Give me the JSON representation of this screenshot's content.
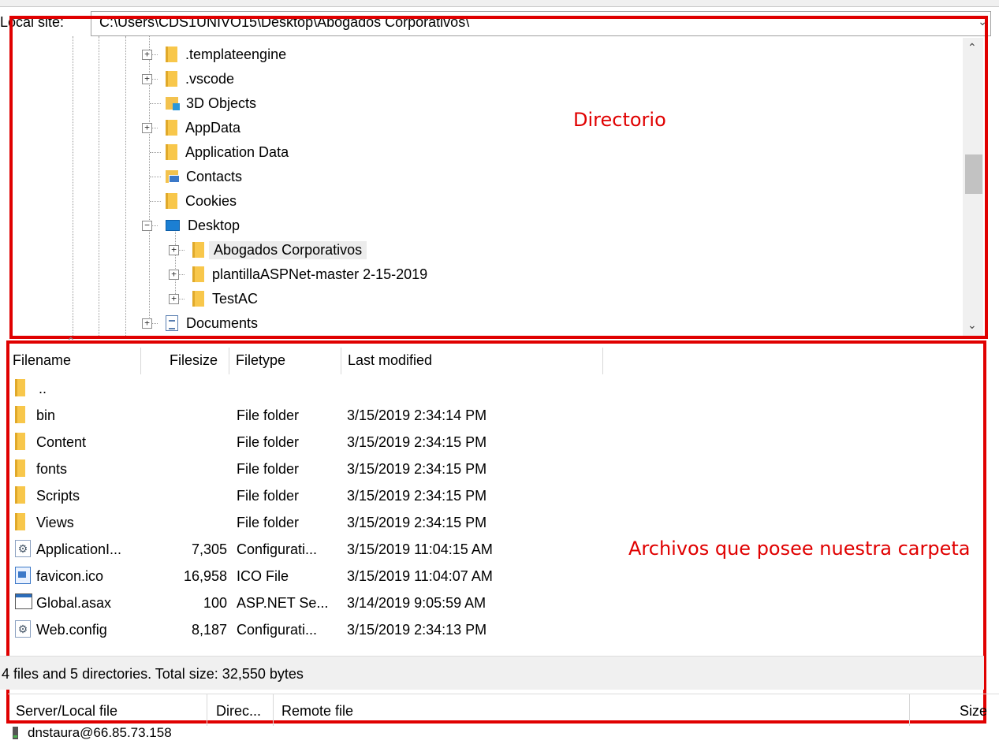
{
  "local_site": {
    "label": "Local site:",
    "path": "C:\\Users\\CDS1UNIVO15\\Desktop\\Abogados Corporativos\\"
  },
  "tree": {
    "items": [
      {
        "label": ".templateengine",
        "expander": "+"
      },
      {
        "label": ".vscode",
        "expander": "+"
      },
      {
        "label": "3D Objects",
        "expander": ""
      },
      {
        "label": "AppData",
        "expander": "+"
      },
      {
        "label": "Application Data",
        "expander": ""
      },
      {
        "label": "Contacts",
        "expander": ""
      },
      {
        "label": "Cookies",
        "expander": ""
      },
      {
        "label": "Desktop",
        "expander": "−"
      },
      {
        "label": "Abogados Corporativos",
        "expander": "+"
      },
      {
        "label": "plantillaASPNet-master 2-15-2019",
        "expander": "+"
      },
      {
        "label": "TestAC",
        "expander": "+"
      },
      {
        "label": "Documents",
        "expander": "+"
      }
    ]
  },
  "annotations": {
    "directory": "Directorio",
    "files": "Archivos que posee nuestra carpeta"
  },
  "file_list": {
    "headers": {
      "filename": "Filename",
      "filesize": "Filesize",
      "filetype": "Filetype",
      "last_modified": "Last modified"
    },
    "rows": [
      {
        "name": "..",
        "size": "",
        "type": "",
        "modified": "",
        "icon": "folder-icon"
      },
      {
        "name": "bin",
        "size": "",
        "type": "File folder",
        "modified": "3/15/2019 2:34:14 PM",
        "icon": "folder-icon"
      },
      {
        "name": "Content",
        "size": "",
        "type": "File folder",
        "modified": "3/15/2019 2:34:15 PM",
        "icon": "folder-icon"
      },
      {
        "name": "fonts",
        "size": "",
        "type": "File folder",
        "modified": "3/15/2019 2:34:15 PM",
        "icon": "folder-icon"
      },
      {
        "name": "Scripts",
        "size": "",
        "type": "File folder",
        "modified": "3/15/2019 2:34:15 PM",
        "icon": "folder-icon"
      },
      {
        "name": "Views",
        "size": "",
        "type": "File folder",
        "modified": "3/15/2019 2:34:15 PM",
        "icon": "folder-icon"
      },
      {
        "name": "ApplicationI...",
        "size": "7,305",
        "type": "Configurati...",
        "modified": "3/15/2019 11:04:15 AM",
        "icon": "config-file-icon"
      },
      {
        "name": "favicon.ico",
        "size": "16,958",
        "type": "ICO File",
        "modified": "3/15/2019 11:04:07 AM",
        "icon": "image-file-icon"
      },
      {
        "name": "Global.asax",
        "size": "100",
        "type": "ASP.NET Se...",
        "modified": "3/14/2019 9:05:59 AM",
        "icon": "asax-file-icon"
      },
      {
        "name": "Web.config",
        "size": "8,187",
        "type": "Configurati...",
        "modified": "3/15/2019 2:34:13 PM",
        "icon": "config-file-icon"
      }
    ]
  },
  "status": "4 files and 5 directories. Total size: 32,550 bytes",
  "queue": {
    "headers": {
      "server_local": "Server/Local file",
      "direction": "Direc...",
      "remote": "Remote file",
      "size": "Size"
    }
  },
  "server": "dnstaura@66.85.73.158",
  "colors": {
    "annotation_red": "#e00000",
    "folder_yellow": "#f8c74b"
  }
}
